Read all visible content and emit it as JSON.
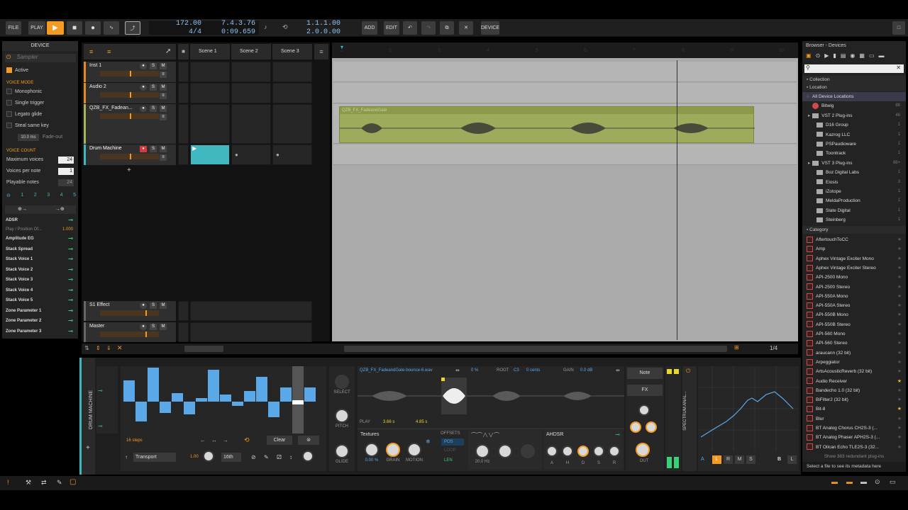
{
  "topbar": {
    "file": "FILE",
    "play": "PLAY",
    "tempo": "172.00",
    "time_sig": "4/4",
    "position": "7.4.3.76",
    "time": "0:09.659",
    "loop_start": "1.1.1.00",
    "loop_len": "2.0.0.00",
    "add": "ADD",
    "edit": "EDIT",
    "device": "DEVICE"
  },
  "device_panel": {
    "title": "DEVICE",
    "sampler_placeholder": "Sampler",
    "active": "Active",
    "voice_mode_title": "VOICE MODE",
    "voice_modes": [
      "Monophonic",
      "Single trigger",
      "Legato glide",
      "Steal same key"
    ],
    "fade_value": "10.0 ms",
    "fade_label": "Fade-out",
    "voice_count_title": "VOICE COUNT",
    "max_voices_label": "Maximum voices",
    "max_voices": "24",
    "voices_per_note_label": "Voices per note",
    "voices_per_note": "1",
    "playable_notes_label": "Playable notes",
    "playable_notes": "24",
    "numbers": [
      "1",
      "2",
      "3",
      "4",
      "5"
    ],
    "adsr": "ADSR",
    "play_position": "Play / Position Of...",
    "play_position_value": "1.000",
    "modulators": [
      "Amplitude EG",
      "Stack Spread",
      "Stack Voice 1",
      "Stack Voice 2",
      "Stack Voice 3",
      "Stack Voice 4",
      "Stack Voice 5",
      "Zone Parameter 1",
      "Zone Parameter 2",
      "Zone Parameter 3"
    ]
  },
  "tracks": {
    "items": [
      {
        "name": "Inst 1",
        "color": "#e08a2e"
      },
      {
        "name": "Audio 2",
        "color": "#e08a2e"
      },
      {
        "name": "QZB_FX_Fadean...",
        "color": "#a3b45a"
      },
      {
        "name": "Drum Machine",
        "color": "#3fb8c0"
      }
    ],
    "effect": "S1 Effect",
    "master": "Master",
    "solo": "S",
    "mute": "M",
    "scenes": [
      "Scene 1",
      "Scene 2",
      "Scene 3"
    ]
  },
  "arranger": {
    "ruler": [
      "1",
      "2",
      "3",
      "4",
      "5",
      "6",
      "7",
      "8",
      "9",
      "10"
    ],
    "clip_name": "QZB_FX_FadeandGate",
    "zoom": "1/4"
  },
  "bottom": {
    "drum_machine": "DRUM MACHINE",
    "steps": "16 steps",
    "clear": "Clear",
    "transport": "Transport",
    "rate_value": "1.00",
    "rate_div": "16th",
    "select": "SELECT",
    "pitch": "PITCH",
    "glide": "GLIDE",
    "sample_name": "QZB_FX_FadeandGate-bounce-6.wav",
    "sample_pct": "0 %",
    "root_label": "ROOT",
    "root": "C3",
    "cents": "0 cents",
    "gain_label": "GAIN",
    "gain": "0.0 dB",
    "play_label": "PLAY",
    "play_start": "3.66 s",
    "play_end": "4.85 s",
    "textures": "Textures",
    "offsets": "OFFSETS",
    "pos": "POS",
    "loop": "LOOP",
    "len": "LEN",
    "knobs": [
      "0.00 %",
      "GRAIN",
      "MOTION"
    ],
    "freq": "20.0 Hz",
    "ahdsr": "AHDSR",
    "env_labels": [
      "A",
      "H",
      "D",
      "S",
      "R"
    ],
    "note": "Note",
    "fx": "FX",
    "out": "OUT",
    "spectrum": "SPECTRUM ANAL...",
    "lr_buttons": [
      "A",
      "L",
      "R",
      "M",
      "S"
    ],
    "b_label": "B",
    "l_label": "L"
  },
  "browser": {
    "title": "Browser - Devices",
    "collection": "Collection",
    "location": "Location",
    "locations": [
      {
        "name": "All Device Locations",
        "count": "",
        "type": "all"
      },
      {
        "name": "Bitwig",
        "count": "88",
        "type": "bitwig"
      },
      {
        "name": "VST 2 Plug-ins",
        "count": "46",
        "type": "folder"
      },
      {
        "name": "D16 Group",
        "count": "1",
        "type": "sub"
      },
      {
        "name": "Kazrog LLC",
        "count": "1",
        "type": "sub"
      },
      {
        "name": "PSPaudioware",
        "count": "1",
        "type": "sub"
      },
      {
        "name": "Toontrack",
        "count": "1",
        "type": "sub"
      },
      {
        "name": "VST 3 Plug-ins",
        "count": "88+",
        "type": "folder"
      },
      {
        "name": "Boz Digital Labs",
        "count": "1",
        "type": "sub"
      },
      {
        "name": "Eiosis",
        "count": "3",
        "type": "sub"
      },
      {
        "name": "iZotope",
        "count": "1",
        "type": "sub"
      },
      {
        "name": "MeldaProduction",
        "count": "1",
        "type": "sub"
      },
      {
        "name": "Slate Digital",
        "count": "1",
        "type": "sub"
      },
      {
        "name": "Steinberg",
        "count": "1",
        "type": "sub"
      }
    ],
    "category": "Category",
    "plugins": [
      {
        "name": "AftertouchToCC",
        "fav": false
      },
      {
        "name": "Amp",
        "fav": false
      },
      {
        "name": "Aphex Vintage Exciter Mono",
        "fav": false
      },
      {
        "name": "Aphex Vintage Exciter Stereo",
        "fav": false
      },
      {
        "name": "API-2500 Mono",
        "fav": false
      },
      {
        "name": "API-2500 Stereo",
        "fav": false
      },
      {
        "name": "API-550A Mono",
        "fav": false
      },
      {
        "name": "API-550A Stereo",
        "fav": false
      },
      {
        "name": "API-550B Mono",
        "fav": false
      },
      {
        "name": "API-550B Stereo",
        "fav": false
      },
      {
        "name": "API-560 Mono",
        "fav": false
      },
      {
        "name": "API-560 Stereo",
        "fav": false
      },
      {
        "name": "araucann (32 bit)",
        "fav": false
      },
      {
        "name": "Arpeggiator",
        "fav": false
      },
      {
        "name": "ArtsAcousticReverb (32 bit)",
        "fav": false
      },
      {
        "name": "Audio Receiver",
        "fav": true
      },
      {
        "name": "Bandecho 1.0 (32 bit)",
        "fav": false
      },
      {
        "name": "BiFilter2 (32 bit)",
        "fav": false
      },
      {
        "name": "Bit-8",
        "fav": true
      },
      {
        "name": "Blur",
        "fav": false
      },
      {
        "name": "BT Analog Chorus CH2S-3 (...",
        "fav": false
      },
      {
        "name": "BT Analog Phaser APH2S-3 (...",
        "fav": false
      },
      {
        "name": "BT Oilcan Echo TLE2S-3 (32...",
        "fav": false
      }
    ],
    "redundant": "Show 383 redundant plug-ins",
    "footer": "Select a file to see its metadata here"
  }
}
